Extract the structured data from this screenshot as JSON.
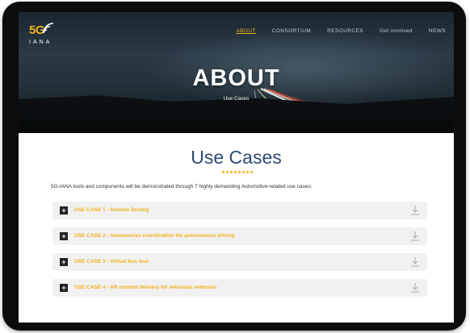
{
  "logo": {
    "mark": "5G",
    "name": "IANA"
  },
  "nav": [
    {
      "label": "ABOUT",
      "active": true
    },
    {
      "label": "CONSORTIUM",
      "active": false
    },
    {
      "label": "RESOURCES",
      "active": false
    },
    {
      "label": "Get involved",
      "active": false
    },
    {
      "label": "NEWS",
      "active": false
    }
  ],
  "hero": {
    "title": "ABOUT",
    "subtitle": "Use Cases"
  },
  "content": {
    "title": "Use Cases",
    "intro": "5G-IANA tools and components will be demonstrated through 7 highly demanding Automotive-related use cases:",
    "use_cases": [
      {
        "label": "USE CASE 1 - Remote Driving"
      },
      {
        "label": "USE CASE 2 - manoeuvres coordination for autonomous driving"
      },
      {
        "label": "USE CASE 3 - Virtual bus tour"
      },
      {
        "label": "USE CASE 4 - AR content delivery for vehicular networks"
      }
    ]
  },
  "icons": {
    "toggle": "plus-icon",
    "download": "download-icon",
    "logo_waves": "signal-waves-icon"
  },
  "colors": {
    "accent": "#f2b21b",
    "title_blue": "#2c4a73",
    "accordion_bg": "#f1f1f1"
  }
}
